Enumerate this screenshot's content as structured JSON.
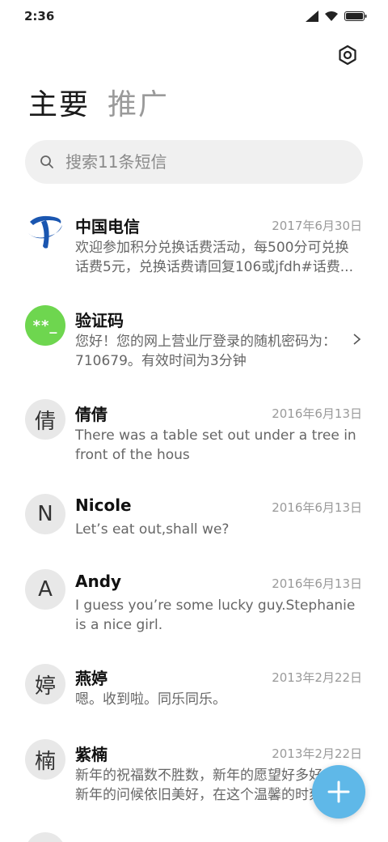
{
  "status": {
    "time": "2:36",
    "icons": [
      "signal-icon",
      "wifi-icon",
      "battery-icon"
    ]
  },
  "header": {
    "settings_icon": "gear-icon",
    "tabs": [
      {
        "label": "主要",
        "active": true
      },
      {
        "label": "推广",
        "active": false
      }
    ]
  },
  "search": {
    "placeholder": "搜索11条短信",
    "value": ""
  },
  "threads": [
    {
      "name": "中国电信",
      "date": "2017年6月30日",
      "preview": "欢迎参加积分兑换话费活动，每500分可兑换话费5元，兑换话费请回复106或jfdh#话费...",
      "avatar": "",
      "avatar_type": "logo"
    },
    {
      "name": "验证码",
      "date": "",
      "preview": "您好！您的网上营业厅登录的随机密码为：710679。有效时间为3分钟",
      "avatar": "**_",
      "avatar_type": "green"
    },
    {
      "name": "倩倩",
      "date": "2016年6月13日",
      "preview": "There was a table set out under a tree in front of the hous",
      "avatar": "倩",
      "avatar_type": "letter"
    },
    {
      "name": "Nicole",
      "date": "2016年6月13日",
      "preview": "Let’s eat out,shall we?",
      "avatar": "N",
      "avatar_type": "letter"
    },
    {
      "name": "Andy",
      "date": "2016年6月13日",
      "preview": "I guess you’re some lucky guy.Stephanie is a nice girl.",
      "avatar": "A",
      "avatar_type": "letter"
    },
    {
      "name": "燕婷",
      "date": "2013年2月22日",
      "preview": "嗯。收到啦。同乐同乐。",
      "avatar": "婷",
      "avatar_type": "letter"
    },
    {
      "name": "紫楠",
      "date": "2013年2月22日",
      "preview": "新年的祝福数不胜数，新年的愿望好多好多，新年的问候依旧美好，在这个温馨的时刻",
      "avatar": "楠",
      "avatar_type": "letter"
    }
  ],
  "fab": {
    "icon": "plus-icon"
  },
  "colors": {
    "accent": "#5fb8e8",
    "green_avatar": "#6ed64f",
    "search_bg": "#f0f0f0"
  }
}
